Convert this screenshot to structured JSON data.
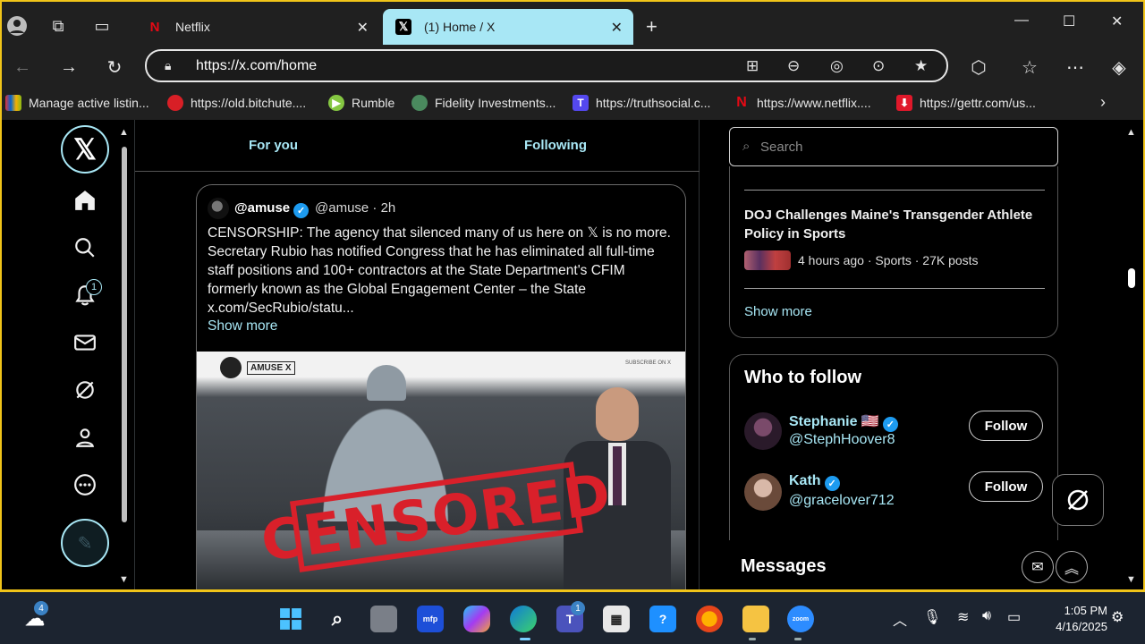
{
  "browser": {
    "tabs": [
      {
        "title": "Netflix",
        "icon": "netflix-icon",
        "active": false
      },
      {
        "title": "(1) Home / X",
        "icon": "x-logo-icon",
        "active": true
      }
    ],
    "url": "https://x.com/home",
    "bookmarks": [
      {
        "label": "Manage active listin..."
      },
      {
        "label": "https://old.bitchute...."
      },
      {
        "label": "Rumble"
      },
      {
        "label": "Fidelity Investments..."
      },
      {
        "label": "https://truthsocial.c..."
      },
      {
        "label": "https://www.netflix...."
      },
      {
        "label": "https://gettr.com/us..."
      }
    ]
  },
  "x": {
    "tabs": {
      "for_you": "For you",
      "following": "Following"
    },
    "notif_count": "1",
    "tweet": {
      "name": "@amuse",
      "handle": "@amuse · 2h",
      "text": "CENSORSHIP: The agency that silenced many of us here on 𝕏 is no more. Secretary Rubio has notified Congress that he has eliminated all full-time staff positions and 100+ contractors at the State Department's CFIM formerly known as the Global Engagement Center – the State  x.com/SecRubio/statu...",
      "show_more": "Show more",
      "media_stamp": "CENSORED",
      "media_brand": "AMUSE X",
      "media_sub": "SUBSCRIBE ON X"
    },
    "search_placeholder": "Search",
    "trend": {
      "title": "DOJ Challenges Maine's Transgender Athlete Policy in Sports",
      "meta": "4 hours ago · Sports · 27K posts",
      "show_more": "Show more"
    },
    "who_to_follow": {
      "heading": "Who to follow",
      "people": [
        {
          "name": "Stephanie 🇺🇸",
          "handle": "@StephHoover8",
          "button": "Follow"
        },
        {
          "name": "Kath",
          "handle": "@gracelover712",
          "button": "Follow"
        }
      ]
    },
    "messages_label": "Messages"
  },
  "taskbar": {
    "weather_badge": "4",
    "teams_badge": "1",
    "time": "1:05 PM",
    "date": "4/16/2025"
  },
  "colors": {
    "accent": "#a8e7f5",
    "frame": "#f0c419",
    "verified": "#1d9bf0",
    "stamp": "#d9202a"
  }
}
